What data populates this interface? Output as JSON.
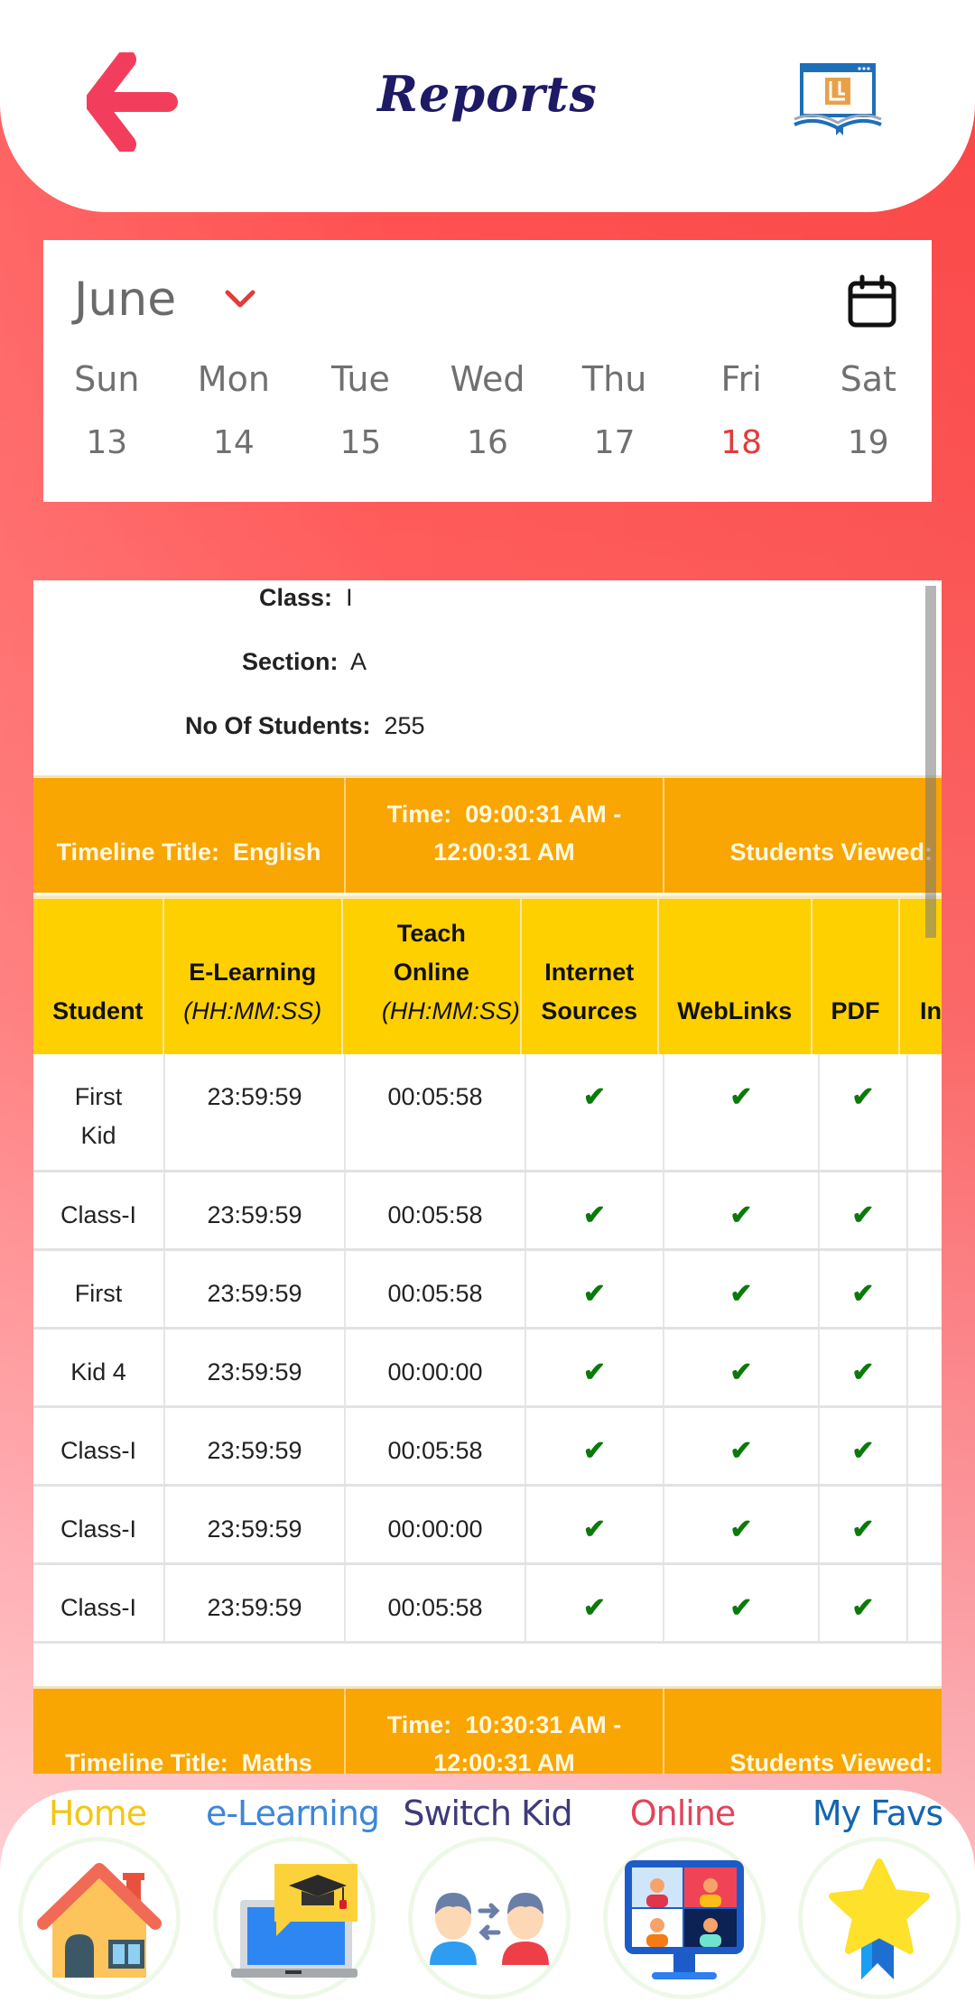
{
  "header": {
    "title": "Reports",
    "back_icon": "back-arrow-icon",
    "logo_icon": "app-logo-book-icon"
  },
  "calendar": {
    "month": "June",
    "month_chevron_icon": "chevron-down-icon",
    "calendar_icon": "calendar-icon",
    "days": [
      {
        "name": "Sun",
        "date": "13"
      },
      {
        "name": "Mon",
        "date": "14"
      },
      {
        "name": "Tue",
        "date": "15"
      },
      {
        "name": "Wed",
        "date": "16"
      },
      {
        "name": "Thu",
        "date": "17"
      },
      {
        "name": "Fri",
        "date": "18"
      },
      {
        "name": "Sat",
        "date": "19"
      }
    ],
    "selected_date": "18",
    "accent_color": "#e23b3b"
  },
  "report": {
    "class_label": "Class:",
    "class_value": "I",
    "section_label": "Section:",
    "section_value": "A",
    "students_label": "No Of Students:",
    "students_value": "255",
    "timelines": [
      {
        "title_label": "Timeline Title:",
        "title_value": "English",
        "time_label": "Time:",
        "time_value": "09:00:31 AM - 12:00:31 AM",
        "viewed_label": "Students Viewed:"
      },
      {
        "title_label": "Timeline Title:",
        "title_value": "Maths",
        "time_label": "Time:",
        "time_value": "10:30:31 AM - 12:00:31 AM",
        "viewed_label": "Students Viewed:"
      }
    ],
    "columns": {
      "student": "Student",
      "elearning": "E-Learning",
      "elearning_unit": "(HH:MM:SS)",
      "teach_online": "Teach Online",
      "teach_online_unit": "(HH:MM:SS)",
      "internet_sources": "Internet Sources",
      "weblinks": "WebLinks",
      "pdf": "PDF",
      "partial_next": "In"
    },
    "check_glyph": "✔",
    "check_color": "#0a7a0a",
    "rows": [
      {
        "student": "First Kid",
        "elearning": "23:59:59",
        "teach_online": "00:05:58",
        "internet_sources": true,
        "weblinks": true,
        "pdf": true
      },
      {
        "student": "Class-I",
        "elearning": "23:59:59",
        "teach_online": "00:05:58",
        "internet_sources": true,
        "weblinks": true,
        "pdf": true
      },
      {
        "student": "First",
        "elearning": "23:59:59",
        "teach_online": "00:05:58",
        "internet_sources": true,
        "weblinks": true,
        "pdf": true
      },
      {
        "student": "Kid 4",
        "elearning": "23:59:59",
        "teach_online": "00:00:00",
        "internet_sources": true,
        "weblinks": true,
        "pdf": true
      },
      {
        "student": "Class-I",
        "elearning": "23:59:59",
        "teach_online": "00:05:58",
        "internet_sources": true,
        "weblinks": true,
        "pdf": true
      },
      {
        "student": "Class-I",
        "elearning": "23:59:59",
        "teach_online": "00:00:00",
        "internet_sources": true,
        "weblinks": true,
        "pdf": true
      },
      {
        "student": "Class-I",
        "elearning": "23:59:59",
        "teach_online": "00:05:58",
        "internet_sources": true,
        "weblinks": true,
        "pdf": true
      }
    ]
  },
  "bottom_nav": [
    {
      "label": "Home",
      "icon": "house-icon",
      "color": "#f2c618"
    },
    {
      "label": "e-Learning",
      "icon": "laptop-graduation-cap-icon",
      "color": "#3d86d8"
    },
    {
      "label": "Switch Kid",
      "icon": "switch-users-icon",
      "color": "#3e3a7a"
    },
    {
      "label": "Online",
      "icon": "video-conference-monitor-icon",
      "color": "#e0455c"
    },
    {
      "label": "My Favs",
      "icon": "star-ribbon-icon",
      "color": "#1565b0"
    }
  ]
}
